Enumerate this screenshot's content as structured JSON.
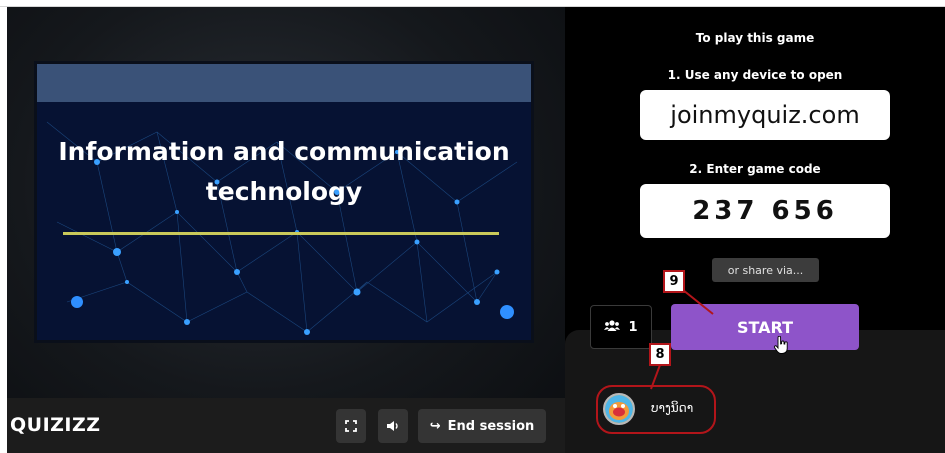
{
  "slide": {
    "title_line1": "Information and communication",
    "title_line2": "technology"
  },
  "footer": {
    "logo_text": "QUIZIZZ",
    "fullscreen_icon": "fullscreen-icon",
    "volume_icon": "volume-icon",
    "end_session_label": "End session",
    "end_session_icon": "logout-icon"
  },
  "join_panel": {
    "heading": "To play this game",
    "step1_label": "1. Use any device to open",
    "join_url": "joinmyquiz.com",
    "step2_label": "2. Enter game code",
    "game_code": "237 656",
    "share_label": "or share via..."
  },
  "lobby": {
    "player_count": "1",
    "players_icon": "users-icon",
    "start_label": "START",
    "players": [
      {
        "name": "ບາງນິດາ"
      }
    ]
  },
  "annotations": [
    {
      "number": "9"
    },
    {
      "number": "8"
    }
  ],
  "colors": {
    "start_button": "#8e54c9",
    "highlight": "#b2151a",
    "slide_accent_line": "#c9c95a"
  }
}
